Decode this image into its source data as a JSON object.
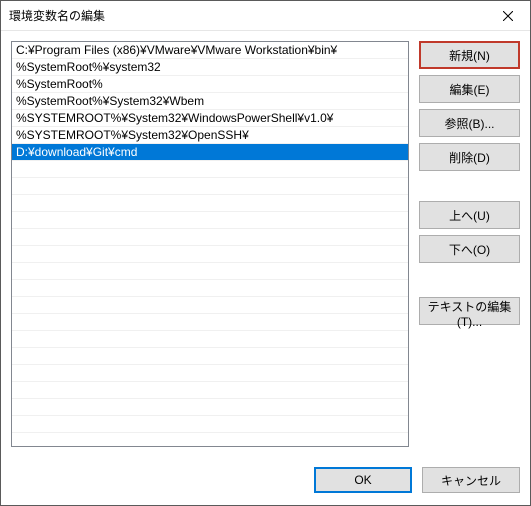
{
  "window": {
    "title": "環境変数名の編集"
  },
  "list": {
    "items": [
      "C:¥Program Files (x86)¥VMware¥VMware Workstation¥bin¥",
      "%SystemRoot%¥system32",
      "%SystemRoot%",
      "%SystemRoot%¥System32¥Wbem",
      "%SYSTEMROOT%¥System32¥WindowsPowerShell¥v1.0¥",
      "%SYSTEMROOT%¥System32¥OpenSSH¥",
      "D:¥download¥Git¥cmd"
    ],
    "selected_index": 6
  },
  "buttons": {
    "new": "新規(N)",
    "edit": "編集(E)",
    "browse": "参照(B)...",
    "delete": "削除(D)",
    "move_up": "上へ(U)",
    "move_down": "下へ(O)",
    "edit_text": "テキストの編集(T)...",
    "ok": "OK",
    "cancel": "キャンセル"
  },
  "colors": {
    "highlight": "#c0392b",
    "selection": "#0078d7"
  }
}
